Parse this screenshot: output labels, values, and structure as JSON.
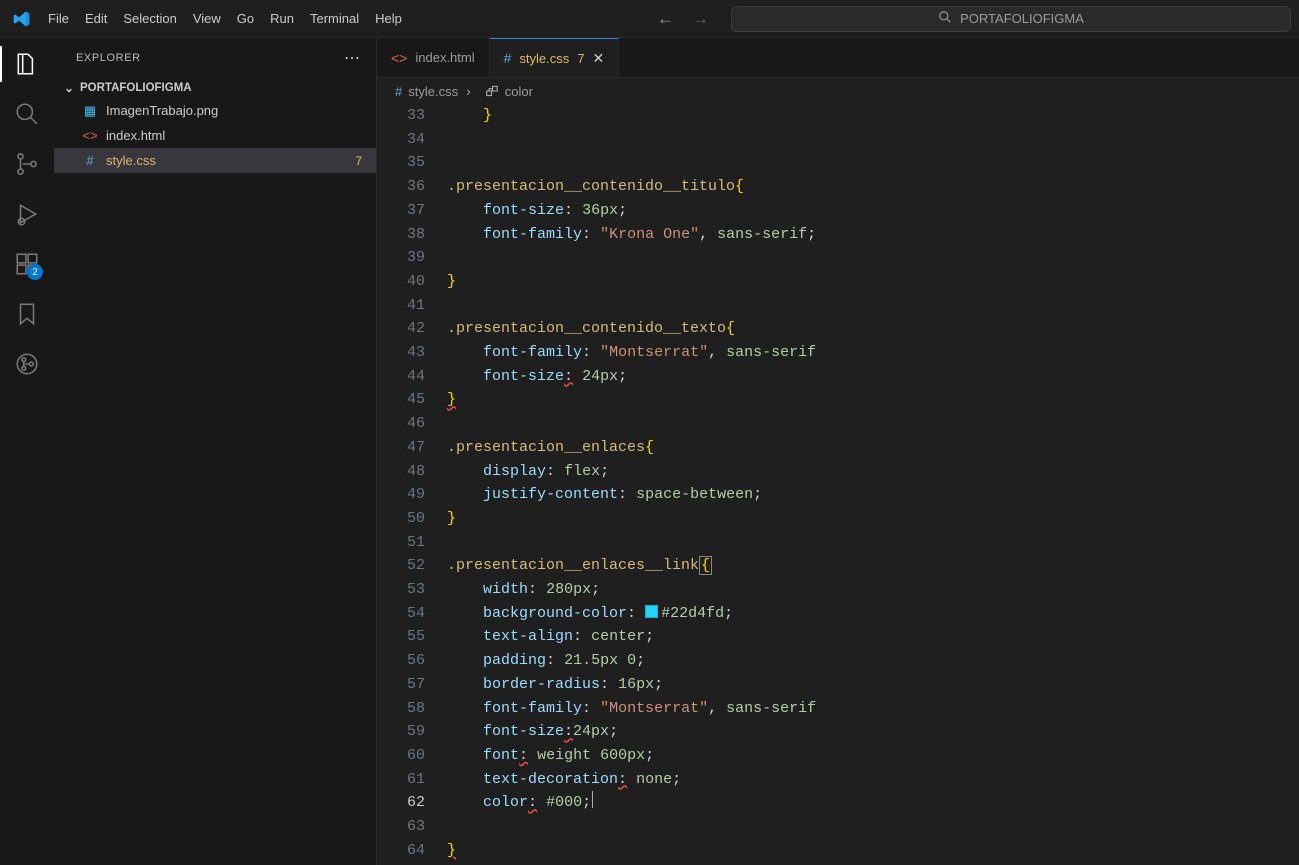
{
  "menu": [
    "File",
    "Edit",
    "Selection",
    "View",
    "Go",
    "Run",
    "Terminal",
    "Help"
  ],
  "search_placeholder": "PORTAFOLIOFIGMA",
  "activity_badge": "2",
  "sidebar": {
    "title": "EXPLORER",
    "folder": "PORTAFOLIOFIGMA",
    "files": [
      {
        "name": "ImagenTrabajo.png",
        "icon": "img"
      },
      {
        "name": "index.html",
        "icon": "html"
      },
      {
        "name": "style.css",
        "icon": "css",
        "modified": true,
        "problems": "7",
        "selected": true
      }
    ]
  },
  "tabs": [
    {
      "label": "index.html",
      "icon": "html",
      "active": false
    },
    {
      "label": "style.css",
      "icon": "css",
      "active": true,
      "modified": "7"
    }
  ],
  "breadcrumb": {
    "file": "style.css",
    "symbol": "color"
  },
  "code_lines": [
    {
      "n": "33",
      "html": "    <span class='c-br'>}</span>"
    },
    {
      "n": "34",
      "html": ""
    },
    {
      "n": "35",
      "html": ""
    },
    {
      "n": "36",
      "html": "<span class='c-sel'>.presentacion__contenido__titulo</span><span class='c-br'>{</span>"
    },
    {
      "n": "37",
      "html": "    <span class='c-prop'>font-size</span><span class='c-pun'>:</span> <span class='c-num'>36px</span><span class='c-pun'>;</span>"
    },
    {
      "n": "38",
      "html": "    <span class='c-prop'>font-family</span><span class='c-pun'>:</span> <span class='c-val'>\"Krona One\"</span><span class='c-pun'>,</span> <span class='c-num'>sans-serif</span><span class='c-pun'>;</span>"
    },
    {
      "n": "39",
      "html": ""
    },
    {
      "n": "40",
      "html": "<span class='c-br'>}</span>"
    },
    {
      "n": "41",
      "html": ""
    },
    {
      "n": "42",
      "html": "<span class='c-sel'>.presentacion__contenido__texto</span><span class='c-br'>{</span>"
    },
    {
      "n": "43",
      "html": "    <span class='c-prop'>font-family</span><span class='c-pun'>:</span> <span class='c-val'>\"Montserrat\"</span><span class='c-pun'>,</span> <span class='c-num'>sans-serif</span>"
    },
    {
      "n": "44",
      "html": "    <span class='c-prop'>font-size</span><span class='c-pun wavy'>:</span> <span class='c-num'>24px</span><span class='c-pun'>;</span>"
    },
    {
      "n": "45",
      "html": "<span class='c-br wavy'>}</span>"
    },
    {
      "n": "46",
      "html": ""
    },
    {
      "n": "47",
      "html": "<span class='c-sel'>.presentacion__enlaces</span><span class='c-br'>{</span>"
    },
    {
      "n": "48",
      "html": "    <span class='c-prop'>display</span><span class='c-pun'>:</span> <span class='c-num'>flex</span><span class='c-pun'>;</span>"
    },
    {
      "n": "49",
      "html": "    <span class='c-prop'>justify-content</span><span class='c-pun'>:</span> <span class='c-num'>space-between</span><span class='c-pun'>;</span>"
    },
    {
      "n": "50",
      "html": "<span class='c-br'>}</span>"
    },
    {
      "n": "51",
      "html": ""
    },
    {
      "n": "52",
      "html": "<span class='c-sel'>.presentacion__enlaces__link</span><span class='bracket-box'><span class='c-br'>{</span></span>"
    },
    {
      "n": "53",
      "html": "    <span class='c-prop'>width</span><span class='c-pun'>:</span> <span class='c-num'>280px</span><span class='c-pun'>;</span>"
    },
    {
      "n": "54",
      "html": "    <span class='c-prop'>background-color</span><span class='c-pun'>:</span> <span class='color-swatch' style='background:#22d4fd'></span><span class='c-num'>#22d4fd</span><span class='c-pun'>;</span>"
    },
    {
      "n": "55",
      "html": "    <span class='c-prop'>text-align</span><span class='c-pun'>:</span> <span class='c-num'>center</span><span class='c-pun'>;</span>"
    },
    {
      "n": "56",
      "html": "    <span class='c-prop'>padding</span><span class='c-pun'>:</span> <span class='c-num'>21.5px 0</span><span class='c-pun'>;</span>"
    },
    {
      "n": "57",
      "html": "    <span class='c-prop'>border-radius</span><span class='c-pun'>:</span> <span class='c-num'>16px</span><span class='c-pun'>;</span>"
    },
    {
      "n": "58",
      "html": "    <span class='c-prop'>font-family</span><span class='c-pun'>:</span> <span class='c-val'>\"Montserrat\"</span><span class='c-pun'>,</span> <span class='c-num'>sans-serif</span>"
    },
    {
      "n": "59",
      "html": "    <span class='c-prop'>font-size</span><span class='c-pun wavy'>:</span><span class='c-num'>24px</span><span class='c-pun'>;</span>"
    },
    {
      "n": "60",
      "html": "    <span class='c-prop'>font</span><span class='c-pun wavy'>:</span> <span class='c-num'>weight 600px</span><span class='c-pun'>;</span>"
    },
    {
      "n": "61",
      "html": "    <span class='c-prop'>text-decoration</span><span class='c-pun wavy'>:</span> <span class='c-num'>none</span><span class='c-pun'>;</span>"
    },
    {
      "n": "62",
      "html": "    <span class='c-prop'>color</span><span class='c-pun wavy'>:</span> <span class='c-num'>#000</span><span class='c-pun'>;</span><span class='cursor-caret'></span>",
      "current": true
    },
    {
      "n": "63",
      "html": ""
    },
    {
      "n": "64",
      "html": "<span class='c-br wavy'>}</span>"
    }
  ]
}
